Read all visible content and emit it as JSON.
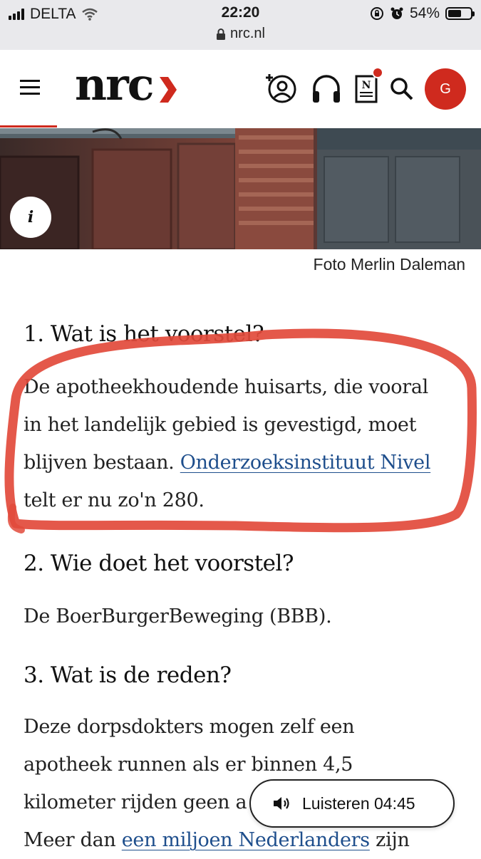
{
  "status_bar": {
    "carrier": "DELTA",
    "time": "22:20",
    "battery": "54%",
    "url": "nrc.nl"
  },
  "header": {
    "logo": "nrc",
    "avatar_initial": "G"
  },
  "photo": {
    "caption": "Foto Merlin Daleman",
    "info_label": "i"
  },
  "article": {
    "q1": {
      "heading": "1. Wat is het voorstel?",
      "text_lines": [
        "De apotheekhoudende huisarts, die vooral",
        "in het landelijk gebied is gevestigd, moet",
        "blijven bestaan. "
      ],
      "link": "Onderzoeksinstituut Nivel",
      "text_tail": "telt er nu zo'n 280."
    },
    "q2": {
      "heading": "2. Wie doet het voorstel?",
      "text": "De BoerBurgerBeweging (BBB)."
    },
    "q3": {
      "heading": "3. Wat is de reden?",
      "lines": [
        "Deze dorpsdokters mogen zelf een",
        "apotheek runnen als er binnen 4,5",
        "kilometer rijden geen a"
      ],
      "last_prefix": "Meer dan ",
      "last_link": "een miljoen Nederlanders",
      "last_suffix": " zijn"
    }
  },
  "listen_button": {
    "label": "Luisteren 04:45"
  },
  "colors": {
    "brand_red": "#cf2a1e",
    "link_blue": "#1e4e8c",
    "annotation_red": "#e24a3b"
  }
}
